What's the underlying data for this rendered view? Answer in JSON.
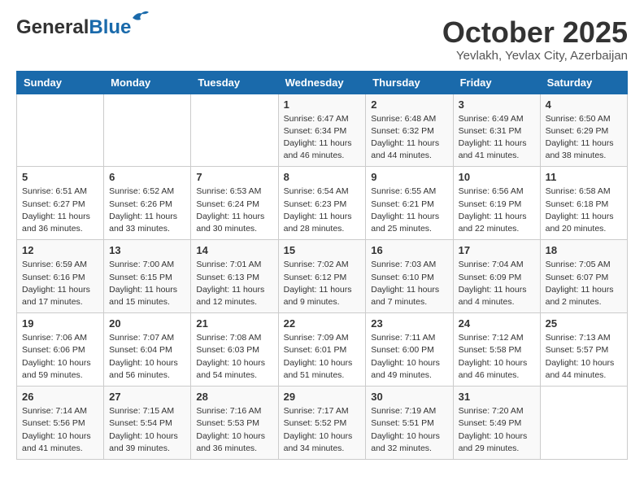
{
  "header": {
    "logo_general": "General",
    "logo_blue": "Blue",
    "month_title": "October 2025",
    "subtitle": "Yevlakh, Yevlax City, Azerbaijan"
  },
  "weekdays": [
    "Sunday",
    "Monday",
    "Tuesday",
    "Wednesday",
    "Thursday",
    "Friday",
    "Saturday"
  ],
  "weeks": [
    [
      {
        "day": "",
        "sunrise": "",
        "sunset": "",
        "daylight": ""
      },
      {
        "day": "",
        "sunrise": "",
        "sunset": "",
        "daylight": ""
      },
      {
        "day": "",
        "sunrise": "",
        "sunset": "",
        "daylight": ""
      },
      {
        "day": "1",
        "sunrise": "6:47 AM",
        "sunset": "6:34 PM",
        "daylight": "11 hours and 46 minutes."
      },
      {
        "day": "2",
        "sunrise": "6:48 AM",
        "sunset": "6:32 PM",
        "daylight": "11 hours and 44 minutes."
      },
      {
        "day": "3",
        "sunrise": "6:49 AM",
        "sunset": "6:31 PM",
        "daylight": "11 hours and 41 minutes."
      },
      {
        "day": "4",
        "sunrise": "6:50 AM",
        "sunset": "6:29 PM",
        "daylight": "11 hours and 38 minutes."
      }
    ],
    [
      {
        "day": "5",
        "sunrise": "6:51 AM",
        "sunset": "6:27 PM",
        "daylight": "11 hours and 36 minutes."
      },
      {
        "day": "6",
        "sunrise": "6:52 AM",
        "sunset": "6:26 PM",
        "daylight": "11 hours and 33 minutes."
      },
      {
        "day": "7",
        "sunrise": "6:53 AM",
        "sunset": "6:24 PM",
        "daylight": "11 hours and 30 minutes."
      },
      {
        "day": "8",
        "sunrise": "6:54 AM",
        "sunset": "6:23 PM",
        "daylight": "11 hours and 28 minutes."
      },
      {
        "day": "9",
        "sunrise": "6:55 AM",
        "sunset": "6:21 PM",
        "daylight": "11 hours and 25 minutes."
      },
      {
        "day": "10",
        "sunrise": "6:56 AM",
        "sunset": "6:19 PM",
        "daylight": "11 hours and 22 minutes."
      },
      {
        "day": "11",
        "sunrise": "6:58 AM",
        "sunset": "6:18 PM",
        "daylight": "11 hours and 20 minutes."
      }
    ],
    [
      {
        "day": "12",
        "sunrise": "6:59 AM",
        "sunset": "6:16 PM",
        "daylight": "11 hours and 17 minutes."
      },
      {
        "day": "13",
        "sunrise": "7:00 AM",
        "sunset": "6:15 PM",
        "daylight": "11 hours and 15 minutes."
      },
      {
        "day": "14",
        "sunrise": "7:01 AM",
        "sunset": "6:13 PM",
        "daylight": "11 hours and 12 minutes."
      },
      {
        "day": "15",
        "sunrise": "7:02 AM",
        "sunset": "6:12 PM",
        "daylight": "11 hours and 9 minutes."
      },
      {
        "day": "16",
        "sunrise": "7:03 AM",
        "sunset": "6:10 PM",
        "daylight": "11 hours and 7 minutes."
      },
      {
        "day": "17",
        "sunrise": "7:04 AM",
        "sunset": "6:09 PM",
        "daylight": "11 hours and 4 minutes."
      },
      {
        "day": "18",
        "sunrise": "7:05 AM",
        "sunset": "6:07 PM",
        "daylight": "11 hours and 2 minutes."
      }
    ],
    [
      {
        "day": "19",
        "sunrise": "7:06 AM",
        "sunset": "6:06 PM",
        "daylight": "10 hours and 59 minutes."
      },
      {
        "day": "20",
        "sunrise": "7:07 AM",
        "sunset": "6:04 PM",
        "daylight": "10 hours and 56 minutes."
      },
      {
        "day": "21",
        "sunrise": "7:08 AM",
        "sunset": "6:03 PM",
        "daylight": "10 hours and 54 minutes."
      },
      {
        "day": "22",
        "sunrise": "7:09 AM",
        "sunset": "6:01 PM",
        "daylight": "10 hours and 51 minutes."
      },
      {
        "day": "23",
        "sunrise": "7:11 AM",
        "sunset": "6:00 PM",
        "daylight": "10 hours and 49 minutes."
      },
      {
        "day": "24",
        "sunrise": "7:12 AM",
        "sunset": "5:58 PM",
        "daylight": "10 hours and 46 minutes."
      },
      {
        "day": "25",
        "sunrise": "7:13 AM",
        "sunset": "5:57 PM",
        "daylight": "10 hours and 44 minutes."
      }
    ],
    [
      {
        "day": "26",
        "sunrise": "7:14 AM",
        "sunset": "5:56 PM",
        "daylight": "10 hours and 41 minutes."
      },
      {
        "day": "27",
        "sunrise": "7:15 AM",
        "sunset": "5:54 PM",
        "daylight": "10 hours and 39 minutes."
      },
      {
        "day": "28",
        "sunrise": "7:16 AM",
        "sunset": "5:53 PM",
        "daylight": "10 hours and 36 minutes."
      },
      {
        "day": "29",
        "sunrise": "7:17 AM",
        "sunset": "5:52 PM",
        "daylight": "10 hours and 34 minutes."
      },
      {
        "day": "30",
        "sunrise": "7:19 AM",
        "sunset": "5:51 PM",
        "daylight": "10 hours and 32 minutes."
      },
      {
        "day": "31",
        "sunrise": "7:20 AM",
        "sunset": "5:49 PM",
        "daylight": "10 hours and 29 minutes."
      },
      {
        "day": "",
        "sunrise": "",
        "sunset": "",
        "daylight": ""
      }
    ]
  ]
}
